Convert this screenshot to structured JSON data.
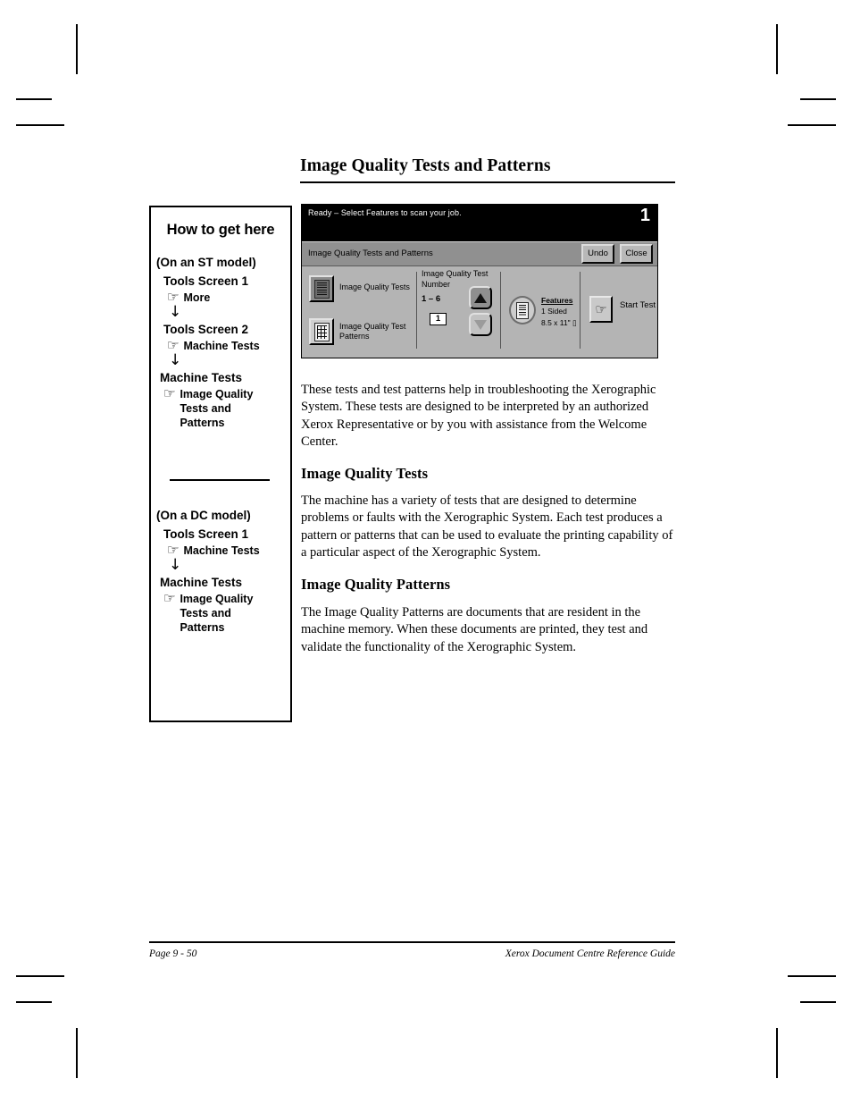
{
  "page_title": "Image Quality Tests and Patterns",
  "howto": {
    "title": "How to get here",
    "hand_icon": "☞",
    "arrow_icon": "↓",
    "st": {
      "model_label": "(On an ST model)",
      "steps": [
        {
          "screen": "Tools Screen 1",
          "selection": "More"
        },
        {
          "screen": "Tools Screen 2",
          "selection": "Machine Tests"
        },
        {
          "screen": "Machine Tests",
          "selection": "Image Quality Tests and Patterns"
        }
      ]
    },
    "dc": {
      "model_label": "(On a DC model)",
      "steps": [
        {
          "screen": "Tools Screen 1",
          "selection": "Machine Tests"
        },
        {
          "screen": "Machine Tests",
          "selection": "Image Quality Tests and Patterns"
        }
      ]
    }
  },
  "ui": {
    "status_text": "Ready –  Select Features to scan your job.",
    "status_number": "1",
    "title": "Image Quality Tests and Patterns",
    "undo_label": "Undo",
    "close_label": "Close",
    "option_tests_label": "Image Quality Tests",
    "option_patterns_label": "Image Quality Test Patterns",
    "number_label": "Image Quality Test Number",
    "number_range": "1 – 6",
    "number_value": "1",
    "features_heading": "Features",
    "features_sided": "1  Sided",
    "features_size": "8.5 x 11\"  ▯",
    "start_test_label": "Start Test",
    "start_test_icon": "☞",
    "colors": {
      "status_bar": "#000000",
      "title_bar": "#909090",
      "panel": "#b4b4b4"
    }
  },
  "body": {
    "intro": "These tests and test patterns help in troubleshooting the Xerographic System. These tests are designed to be interpreted by an authorized Xerox Representative or by you with assistance from the Welcome Center.",
    "h_tests": "Image Quality Tests",
    "p_tests": "The machine has a variety of tests that are designed to determine problems or faults with the Xerographic System. Each test produces a pattern or patterns that can be used to evaluate the printing capability of a particular aspect of the Xerographic System.",
    "h_patterns": "Image Quality Patterns",
    "p_patterns": "The Image Quality Patterns are documents that are resident in the machine memory. When these documents are printed, they test and validate the functionality of the Xerographic System."
  },
  "footer": {
    "page": "Page 9 - 50",
    "guide": "Xerox Document Centre Reference Guide"
  }
}
